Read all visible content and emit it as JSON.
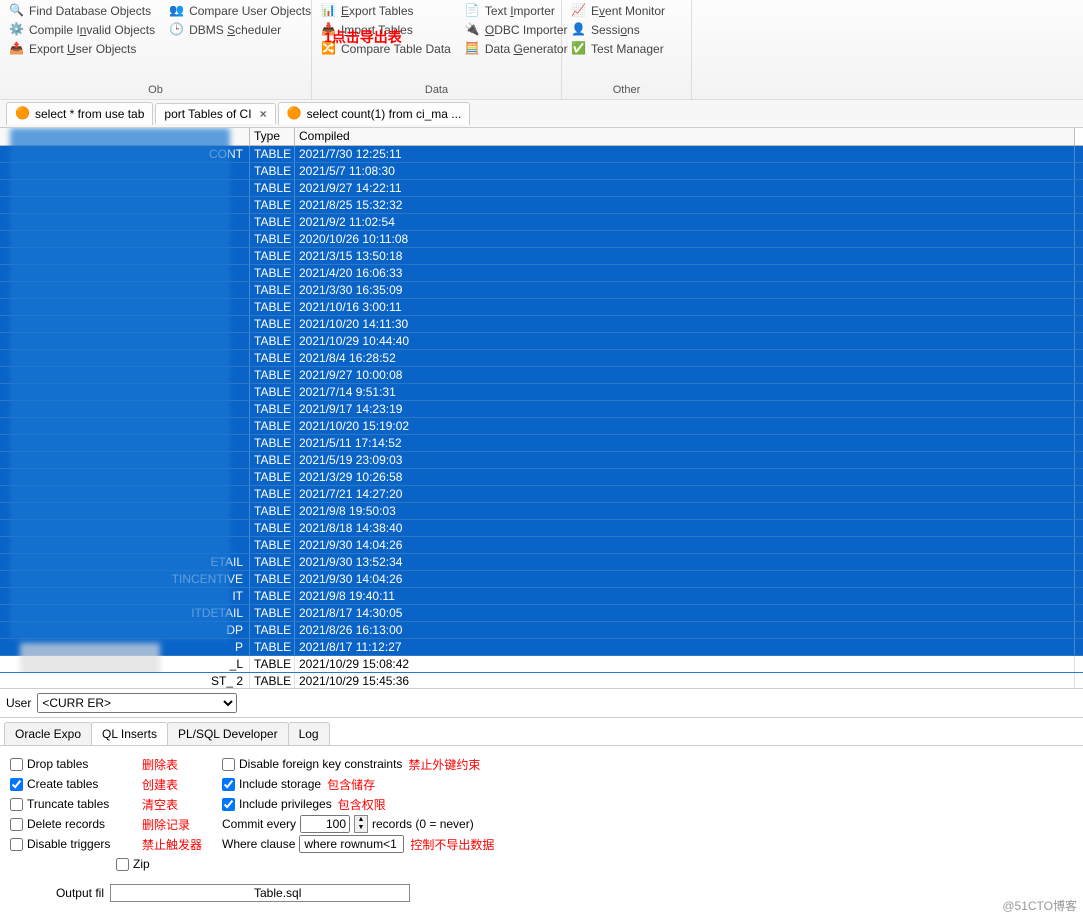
{
  "ribbon": {
    "objects": {
      "label": "Ob",
      "find": "Find Database Objects",
      "compile": "Compile Invalid Objects",
      "exportUser": "Export User Objects",
      "compareUser": "Compare User Objects",
      "dbms": "DBMS Scheduler"
    },
    "data": {
      "label": "Data",
      "exportTables": "Export Tables",
      "importTables": "Import Tables",
      "compareTable": "Compare Table Data",
      "textImporter": "Text Importer",
      "odbcImporter": "ODBC Importer",
      "dataGenerator": "Data Generator"
    },
    "other": {
      "label": "Other",
      "eventMonitor": "Event Monitor",
      "sessions": "Sessions",
      "testManager": "Test Manager"
    }
  },
  "annotation1": "1点击导出表",
  "tabs": {
    "t1": "select * from use   tab",
    "t2": "port Tables of CI",
    "t3": "select count(1) from ci_ma ..."
  },
  "grid": {
    "headers": {
      "name": " ",
      "type": "Type",
      "compiled": "Compiled"
    },
    "rows": [
      {
        "name": "CONT",
        "type": "TABLE",
        "compiled": "2021/7/30 12:25:11",
        "sel": true
      },
      {
        "name": "",
        "type": "TABLE",
        "compiled": "2021/5/7 11:08:30",
        "sel": true
      },
      {
        "name": "",
        "type": "TABLE",
        "compiled": "2021/9/27 14:22:11",
        "sel": true
      },
      {
        "name": "",
        "type": "TABLE",
        "compiled": "2021/8/25 15:32:32",
        "sel": true
      },
      {
        "name": "",
        "type": "TABLE",
        "compiled": "2021/9/2 11:02:54",
        "sel": true
      },
      {
        "name": "",
        "type": "TABLE",
        "compiled": "2020/10/26 10:11:08",
        "sel": true
      },
      {
        "name": "",
        "type": "TABLE",
        "compiled": "2021/3/15 13:50:18",
        "sel": true
      },
      {
        "name": "",
        "type": "TABLE",
        "compiled": "2021/4/20 16:06:33",
        "sel": true
      },
      {
        "name": "",
        "type": "TABLE",
        "compiled": "2021/3/30 16:35:09",
        "sel": true
      },
      {
        "name": "",
        "type": "TABLE",
        "compiled": "2021/10/16 3:00:11",
        "sel": true
      },
      {
        "name": "",
        "type": "TABLE",
        "compiled": "2021/10/20 14:11:30",
        "sel": true
      },
      {
        "name": "",
        "type": "TABLE",
        "compiled": "2021/10/29 10:44:40",
        "sel": true
      },
      {
        "name": "",
        "type": "TABLE",
        "compiled": "2021/8/4 16:28:52",
        "sel": true
      },
      {
        "name": "",
        "type": "TABLE",
        "compiled": "2021/9/27 10:00:08",
        "sel": true
      },
      {
        "name": "",
        "type": "TABLE",
        "compiled": "2021/7/14 9:51:31",
        "sel": true
      },
      {
        "name": "",
        "type": "TABLE",
        "compiled": "2021/9/17 14:23:19",
        "sel": true
      },
      {
        "name": "",
        "type": "TABLE",
        "compiled": "2021/10/20 15:19:02",
        "sel": true
      },
      {
        "name": "",
        "type": "TABLE",
        "compiled": "2021/5/11 17:14:52",
        "sel": true
      },
      {
        "name": "",
        "type": "TABLE",
        "compiled": "2021/5/19 23:09:03",
        "sel": true
      },
      {
        "name": "",
        "type": "TABLE",
        "compiled": "2021/3/29 10:26:58",
        "sel": true
      },
      {
        "name": "",
        "type": "TABLE",
        "compiled": "2021/7/21 14:27:20",
        "sel": true
      },
      {
        "name": "",
        "type": "TABLE",
        "compiled": "2021/9/8 19:50:03",
        "sel": true
      },
      {
        "name": "",
        "type": "TABLE",
        "compiled": "2021/8/18 14:38:40",
        "sel": true
      },
      {
        "name": "",
        "type": "TABLE",
        "compiled": "2021/9/30 14:04:26",
        "sel": true
      },
      {
        "name": "ETAIL",
        "type": "TABLE",
        "compiled": "2021/9/30 13:52:34",
        "sel": true
      },
      {
        "name": "TINCENTIVE",
        "type": "TABLE",
        "compiled": "2021/9/30 14:04:26",
        "sel": true
      },
      {
        "name": "IT",
        "type": "TABLE",
        "compiled": "2021/9/8 19:40:11",
        "sel": true
      },
      {
        "name": "ITDETAIL",
        "type": "TABLE",
        "compiled": "2021/8/17 14:30:05",
        "sel": true
      },
      {
        "name": "DP",
        "type": "TABLE",
        "compiled": "2021/8/26 16:13:00",
        "sel": true
      },
      {
        "name": "P",
        "type": "TABLE",
        "compiled": "2021/8/17 11:12:27",
        "sel": true
      },
      {
        "name": "_L",
        "type": "TABLE",
        "compiled": "2021/10/29 15:08:42",
        "sel": false
      },
      {
        "name": "ST_          2",
        "type": "TABLE",
        "compiled": "2021/10/29 15:45:36",
        "sel": false
      }
    ]
  },
  "userBar": {
    "label": "User",
    "value": "<CURR        ER>"
  },
  "optTabs": {
    "t1": "Oracle Expo",
    "t2": "QL Inserts",
    "t3": "PL/SQL Developer",
    "t4": "Log"
  },
  "options": {
    "dropTables": {
      "label": "Drop tables",
      "checked": false,
      "annot": "删除表"
    },
    "createTables": {
      "label": "Create tables",
      "checked": true,
      "annot": "创建表"
    },
    "truncateTables": {
      "label": "Truncate tables",
      "checked": false,
      "annot": "清空表"
    },
    "deleteRecords": {
      "label": "Delete records",
      "checked": false,
      "annot": "删除记录"
    },
    "disableTriggers": {
      "label": "Disable triggers",
      "checked": false,
      "annot": "禁止触发器"
    },
    "zip": {
      "label": "Zip",
      "checked": false
    },
    "disableFK": {
      "label": "Disable foreign key constraints",
      "checked": false,
      "annot": "禁止外键约束"
    },
    "includeStorage": {
      "label": "Include storage",
      "checked": true,
      "annot": "包含储存"
    },
    "includePrivileges": {
      "label": "Include privileges",
      "checked": true,
      "annot": "包含权限"
    },
    "commitEvery": {
      "label": "Commit every",
      "value": "100",
      "suffix": "records (0 = never)"
    },
    "whereClause": {
      "label": "Where clause",
      "value": "where rownum<1",
      "annot": "控制不导出数据"
    }
  },
  "output": {
    "label": "Output fil",
    "value": "Table.sql"
  },
  "watermark": "@51CTO博客"
}
